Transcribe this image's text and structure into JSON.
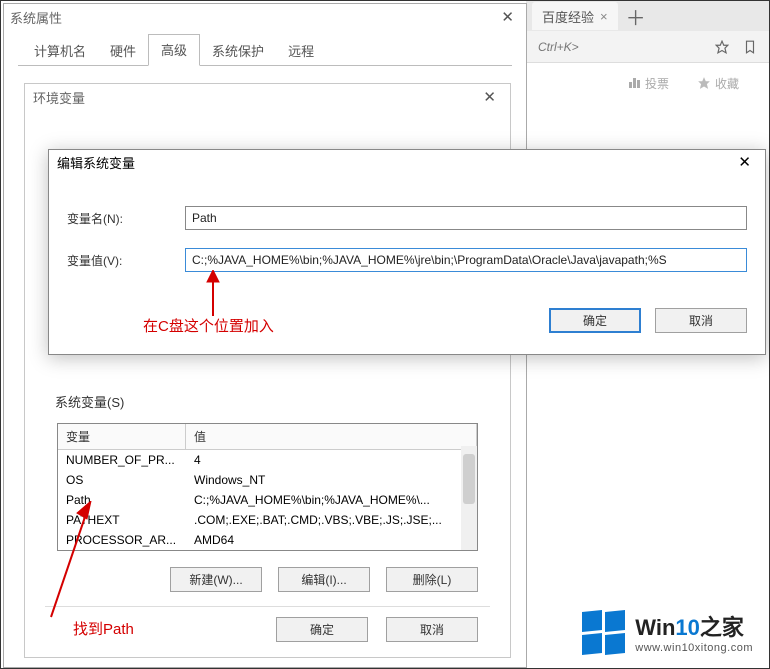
{
  "browser": {
    "tab_title": "百度经验",
    "search_placeholder": "Ctrl+K>",
    "sub_actions": {
      "vote": "投票",
      "favorite": "收藏"
    }
  },
  "sysprops": {
    "title": "系统属性",
    "tabs": [
      "计算机名",
      "硬件",
      "高级",
      "系统保护",
      "远程"
    ],
    "active_tab": "高级"
  },
  "envvars": {
    "title": "环境变量",
    "system_group": "系统变量(S)",
    "columns": {
      "name": "变量",
      "value": "值"
    },
    "rows": [
      {
        "name": "NUMBER_OF_PR...",
        "value": "4"
      },
      {
        "name": "OS",
        "value": "Windows_NT"
      },
      {
        "name": "Path",
        "value": "C:;%JAVA_HOME%\\bin;%JAVA_HOME%\\..."
      },
      {
        "name": "PATHEXT",
        "value": ".COM;.EXE;.BAT;.CMD;.VBS;.VBE;.JS;.JSE;..."
      },
      {
        "name": "PROCESSOR_AR...",
        "value": "AMD64"
      }
    ],
    "buttons": {
      "new": "新建(W)...",
      "edit": "编辑(I)...",
      "delete": "删除(L)"
    },
    "bottom": {
      "ok": "确定",
      "cancel": "取消"
    }
  },
  "editvar": {
    "title": "编辑系统变量",
    "name_label": "变量名(N):",
    "name_value": "Path",
    "value_label": "变量值(V):",
    "value_value": "C:;%JAVA_HOME%\\bin;%JAVA_HOME%\\jre\\bin;\\ProgramData\\Oracle\\Java\\javapath;%S",
    "ok": "确定",
    "cancel": "取消"
  },
  "annotations": {
    "note_top": "在C盘这个位置加入",
    "note_bottom": "找到Path"
  },
  "watermark": {
    "title_a": "Win",
    "title_b": "10",
    "title_c": "之家",
    "url": "www.win10xitong.com"
  }
}
